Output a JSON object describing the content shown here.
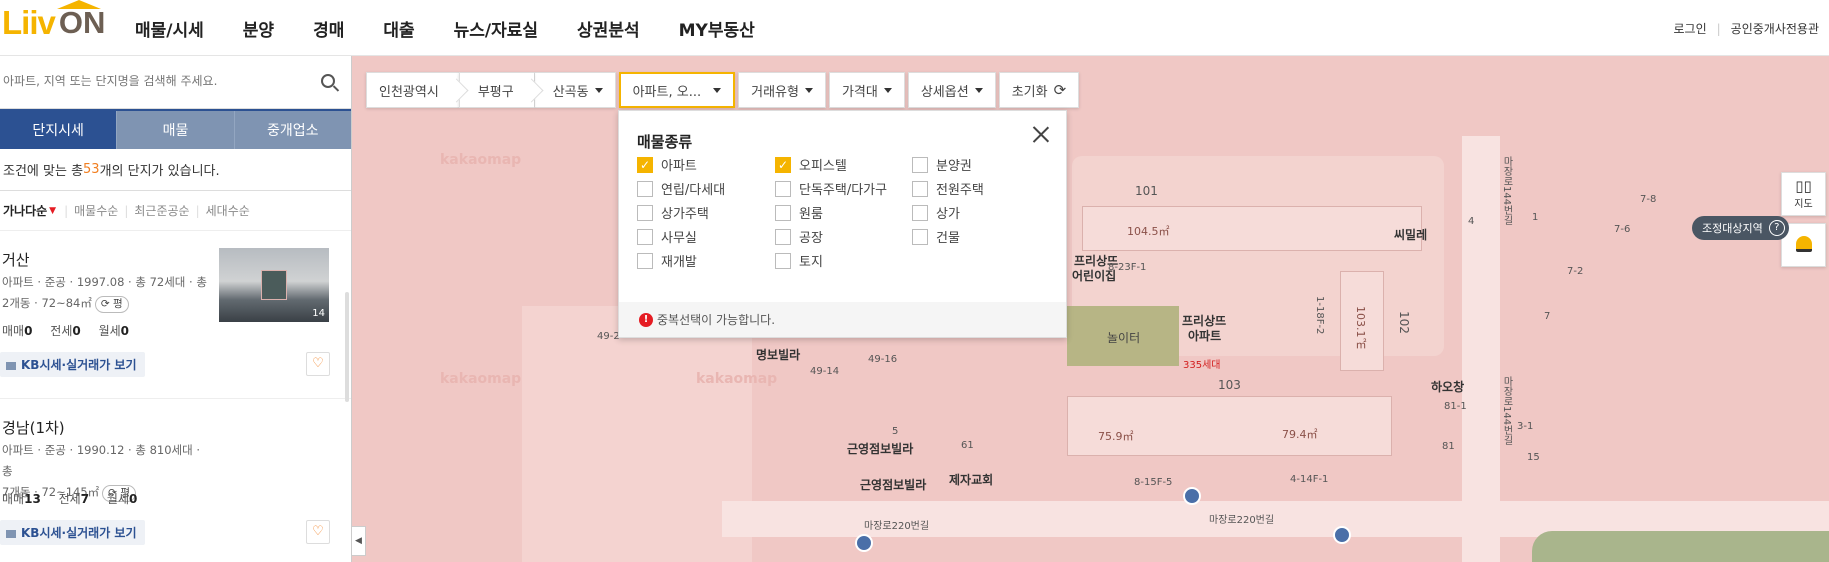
{
  "brand": {
    "logo_a": "Liiv",
    "logo_b": "ON"
  },
  "nav": [
    "매물/시세",
    "분양",
    "경매",
    "대출",
    "뉴스/자료실",
    "상권분석",
    "MY부동산"
  ],
  "top_links": {
    "login": "로그인",
    "agent": "공인중개사전용관"
  },
  "sidebar": {
    "search_placeholder": "아파트, 지역 또는 단지명을 검색해 주세요.",
    "tabs": [
      "단지시세",
      "매물",
      "중개업소"
    ],
    "count_pre": "조건에 맞는 총 ",
    "count_num": "53",
    "count_post": "개의 단지가 있습니다.",
    "sort": [
      "가나다순",
      "매물수순",
      "최근준공순",
      "세대수순"
    ],
    "kb_label": "KB시세·실거래가 보기",
    "items": [
      {
        "name": "거산",
        "meta1": "아파트 · 준공 · 1997.08 · 총 72세대 · 총",
        "meta2": "2개동 · 72~84㎡",
        "pill": "평",
        "sale_label": "매매",
        "sale": "0",
        "jeonse_label": "전세",
        "jeonse": "0",
        "monthly_label": "월세",
        "monthly": "0",
        "photo_count": "14"
      },
      {
        "name": "경남(1차)",
        "meta1": "아파트 · 준공 · 1990.12 · 총 810세대 · 총",
        "meta2": "7개동 · 72~145㎡",
        "pill": "평",
        "sale_label": "매매",
        "sale": "13",
        "jeonse_label": "전세",
        "jeonse": "7",
        "monthly_label": "월세",
        "monthly": "0"
      }
    ]
  },
  "filters": {
    "breadcrumb": [
      "인천광역시",
      "부평구",
      "산곡동"
    ],
    "property_type": "아파트, 오...",
    "deal_type": "거래유형",
    "price": "가격대",
    "detail": "상세옵션",
    "reset": "초기화"
  },
  "dropdown": {
    "title": "매물종류",
    "options": [
      {
        "label": "아파트",
        "checked": true
      },
      {
        "label": "오피스텔",
        "checked": true
      },
      {
        "label": "분양권",
        "checked": false
      },
      {
        "label": "연립/다세대",
        "checked": false
      },
      {
        "label": "단독주택/다가구",
        "checked": false
      },
      {
        "label": "전원주택",
        "checked": false
      },
      {
        "label": "상가주택",
        "checked": false
      },
      {
        "label": "원룸",
        "checked": false
      },
      {
        "label": "상가",
        "checked": false
      },
      {
        "label": "사무실",
        "checked": false
      },
      {
        "label": "공장",
        "checked": false
      },
      {
        "label": "건물",
        "checked": false
      },
      {
        "label": "재개발",
        "checked": false
      },
      {
        "label": "토지",
        "checked": false
      }
    ],
    "note": "중복선택이 가능합니다."
  },
  "map": {
    "watermark": "kakaomap",
    "labels": {
      "b101": "101",
      "b101_area": "104.5㎡",
      "b103": "103",
      "b103_area1": "75.9㎡",
      "b103_area2": "79.4㎡",
      "b102": "102",
      "b102_area": "103.1㎡",
      "kinder1": "프리상뜨",
      "kinder2": "어린이집",
      "apt1": "프리상뜨",
      "apt2": "아파트",
      "households": "335세대",
      "playground": "놀이터",
      "simile": "씨밀레",
      "haochang": "하오창",
      "myungbo": "명보빌라",
      "geunyoung1": "근영점보빌라",
      "geunyoung2": "근영점보빌라",
      "jeja": "제자교회",
      "addr1": "8-23F-1",
      "addr2": "8-15F-5",
      "addr3": "4-14F-1",
      "addr4": "1-18F-2",
      "road1": "마장로220번길",
      "road2": "마장로220번길",
      "road3": "마장로144번길",
      "road4": "마장로144번길",
      "n49_2": "49-2",
      "n49_16": "49-16",
      "n49_14": "49-14",
      "n61": "61",
      "n5": "5",
      "n4": "4",
      "n1": "1",
      "n7_8": "7-8",
      "n7_6": "7-6",
      "n7_2": "7-2",
      "n7": "7",
      "n81": "81",
      "n81_1": "81-1",
      "n3_1": "3-1",
      "n15": "15"
    }
  },
  "right_tools": {
    "map_label": "지도",
    "tooltip": "조정대상지역",
    "tooltip_q": "?"
  },
  "colors": {
    "accent": "#f5b400",
    "navy": "#2c5192",
    "count": "#f17f21",
    "map_bg": "#f0c8c5"
  }
}
